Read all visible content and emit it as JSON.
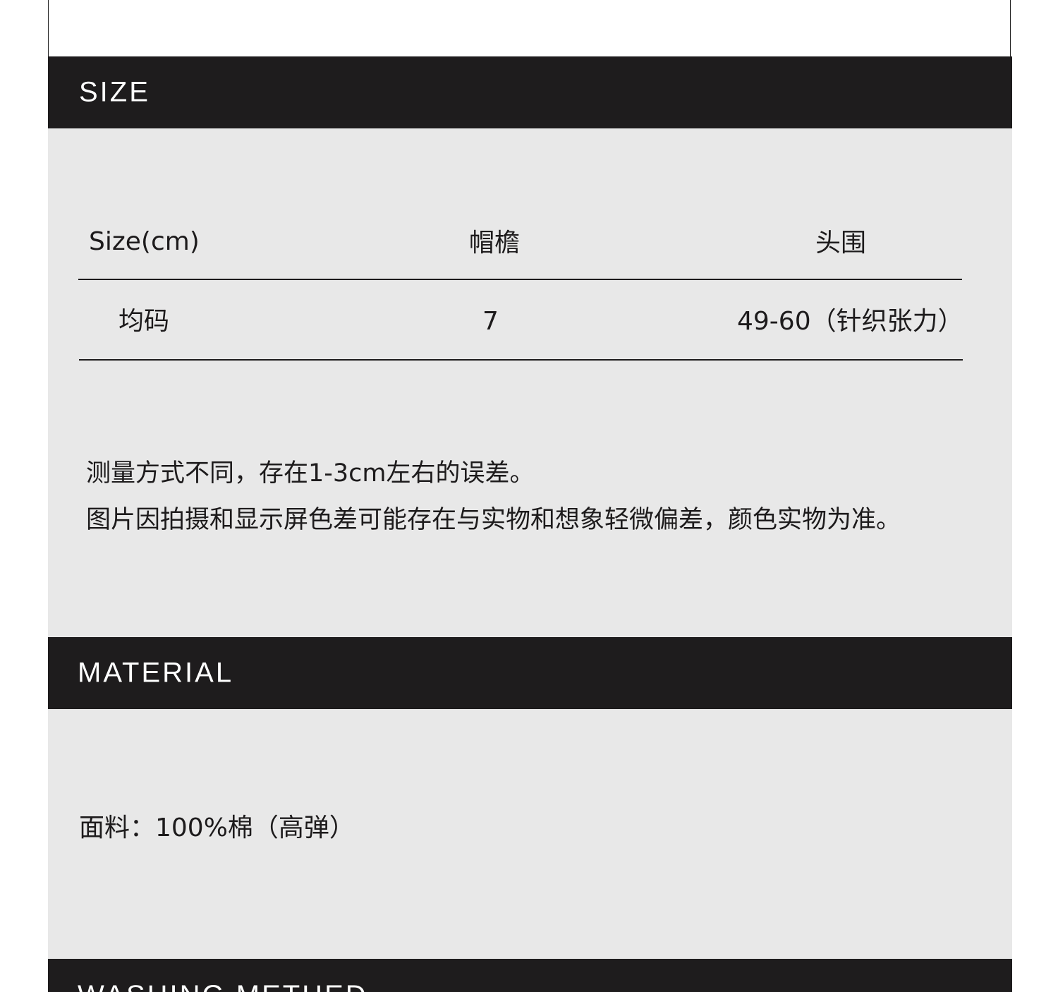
{
  "size_section": {
    "title": "SIZE",
    "table": {
      "headers": [
        "Size(cm)",
        "帽檐",
        "头围"
      ],
      "rows": [
        [
          "均码",
          "7",
          "49-60（针织张力）"
        ]
      ]
    },
    "notes": [
      "测量方式不同，存在1-3cm左右的误差。",
      "图片因拍摄和显示屏色差可能存在与实物和想象轻微偏差，颜色实物为准。"
    ]
  },
  "material_section": {
    "title": "MATERIAL",
    "fabric": "面料：100%棉（高弹）"
  },
  "washing_section": {
    "title": "WASHING METHED"
  }
}
